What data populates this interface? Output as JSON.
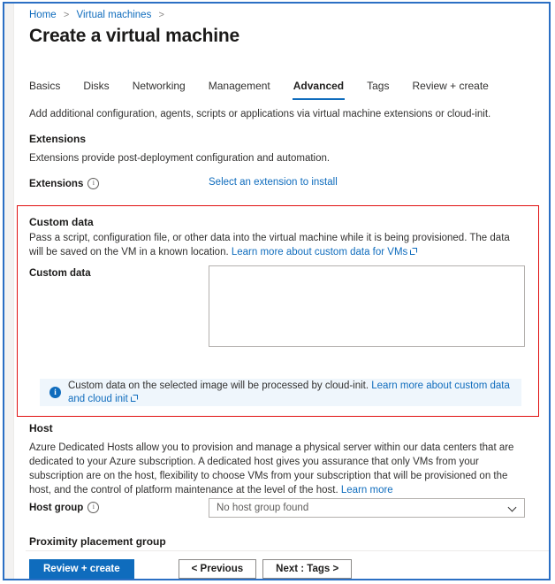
{
  "breadcrumb": {
    "items": [
      {
        "label": "Home"
      },
      {
        "label": "Virtual machines"
      }
    ],
    "separator": ">"
  },
  "header": {
    "title": "Create a virtual machine"
  },
  "tabs": [
    {
      "label": "Basics",
      "selected": false
    },
    {
      "label": "Disks",
      "selected": false
    },
    {
      "label": "Networking",
      "selected": false
    },
    {
      "label": "Management",
      "selected": false
    },
    {
      "label": "Advanced",
      "selected": true
    },
    {
      "label": "Tags",
      "selected": false
    },
    {
      "label": "Review + create",
      "selected": false
    }
  ],
  "intro": "Add additional configuration, agents, scripts or applications via virtual machine extensions or cloud-init.",
  "extensions": {
    "heading": "Extensions",
    "description": "Extensions provide post-deployment configuration and automation.",
    "field_label": "Extensions",
    "info_icon": "info-circle-icon",
    "select_link": "Select an extension to install"
  },
  "custom_data": {
    "heading": "Custom data",
    "description_part1": "Pass a script, configuration file, or other data into the virtual machine while it is being provisioned. The data will be saved on the VM in a known location. ",
    "learn_more_link": "Learn more about custom data for VMs",
    "external_icon": "external-link-icon",
    "field_label": "Custom data",
    "textarea_value": "",
    "textarea_placeholder": "",
    "banner": {
      "icon": "info-filled-icon",
      "text": "Custom data on the selected image will be processed by cloud-init. ",
      "link": "Learn more about custom data and cloud init",
      "external_icon": "external-link-icon"
    }
  },
  "host": {
    "heading": "Host",
    "description": "Azure Dedicated Hosts allow you to provision and manage a physical server within our data centers that are dedicated to your Azure subscription. A dedicated host gives you assurance that only VMs from your subscription are on the host, flexibility to choose VMs from your subscription that will be provisioned on the host, and the control of platform maintenance at the level of the host. ",
    "learn_more_link": "Learn more",
    "host_group_label": "Host group",
    "info_icon": "info-circle-icon",
    "host_group_value": "No host group found",
    "chevron_icon": "chevron-down-icon"
  },
  "proximity_placement_group": {
    "heading": "Proximity placement group"
  },
  "footer": {
    "review_create": "Review + create",
    "previous": "< Previous",
    "next": "Next : Tags >"
  },
  "colors": {
    "accent": "#0f6cbd",
    "highlight_box": "#e01010",
    "banner_bg": "#eff6fc",
    "page_border": "#2b6fc4"
  }
}
